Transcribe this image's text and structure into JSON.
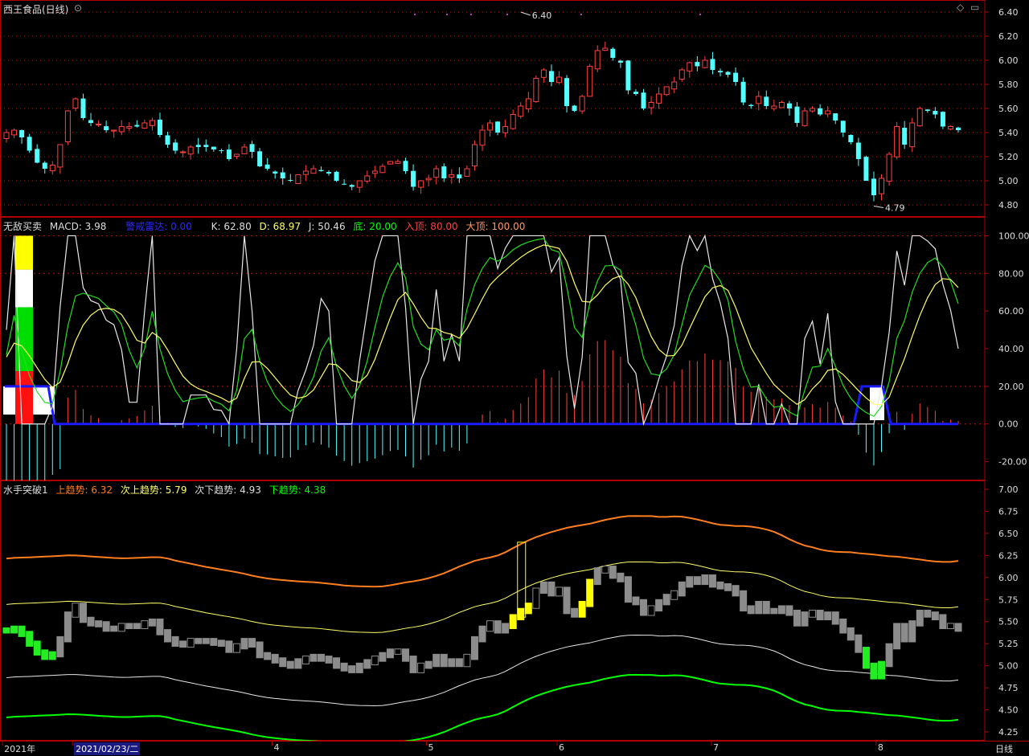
{
  "colors": {
    "up": "#ff4040",
    "down": "#54ffff",
    "grid_red": "#c01010",
    "frame": "#b00000",
    "white": "#e8e8e8",
    "yellow": "#ffff66",
    "green": "#00ff00",
    "blue": "#1a1aff",
    "orange": "#ff7f1e",
    "gray": "#8c8c8c",
    "peach": "#f2be96"
  },
  "header": {
    "stock_name": "西王食品(日线)",
    "dropdown_icon": "chevron-down-icon",
    "diamond_icon": "diamond-icon",
    "scroll_icon": "scroll-handle-icon"
  },
  "indicator1": {
    "name": "无敌买卖",
    "macd_label": "MACD: 3.98",
    "radar_label": "警戒雷达: 0.00",
    "k_label": "K: 62.80",
    "d_label": "D: 68.97",
    "j_label": "J: 50.46",
    "bottom_label": "底: 20.00",
    "entry_top_label": "入顶: 80.00",
    "big_top_label": "大顶: 100.00"
  },
  "indicator2": {
    "name": "水手突破1",
    "up_trend_label": "上趋势: 6.32",
    "sub_up_label": "次上趋势: 5.79",
    "sub_down_label": "次下趋势: 4.93",
    "down_trend_label": "下趋势: 4.38"
  },
  "datebar": {
    "labels": [
      {
        "text": "2021年",
        "pos": 0.004
      },
      {
        "text": "2021/02/23/二",
        "pos": 0.072,
        "selected": true
      },
      {
        "text": "4",
        "pos": 0.266
      },
      {
        "text": "5",
        "pos": 0.416
      },
      {
        "text": "6",
        "pos": 0.543
      },
      {
        "text": "7",
        "pos": 0.693
      },
      {
        "text": "8",
        "pos": 0.853
      }
    ],
    "period": "日线"
  },
  "chart_data": [
    {
      "type": "candlestick",
      "ylim": [
        4.7,
        6.5
      ],
      "y_ticks": [
        "6.40",
        "6.20",
        "6.00",
        "5.80",
        "5.60",
        "5.40",
        "5.20",
        "5.00",
        "4.80"
      ],
      "annotations": [
        {
          "text": "6.40",
          "label": "high"
        },
        {
          "text": "4.79",
          "label": "low"
        }
      ],
      "close_path": [
        5.4,
        5.42,
        5.36,
        5.25,
        5.15,
        5.1,
        5.13,
        5.3,
        5.58,
        5.68,
        5.52,
        5.48,
        5.47,
        5.42,
        5.42,
        5.45,
        5.45,
        5.45,
        5.48,
        5.5,
        5.38,
        5.3,
        5.25,
        5.24,
        5.28,
        5.28,
        5.28,
        5.26,
        5.25,
        5.18,
        5.22,
        5.28,
        5.24,
        5.12,
        5.1,
        5.06,
        5.02,
        5.0,
        5.05,
        5.08,
        5.1,
        5.08,
        5.06,
        5.0,
        4.97,
        4.95,
        5.0,
        5.04,
        5.08,
        5.12,
        5.16,
        5.16,
        5.08,
        4.95,
        5.0,
        5.02,
        5.1,
        5.02,
        5.05,
        5.02,
        5.1,
        5.3,
        5.42,
        5.48,
        5.4,
        5.45,
        5.55,
        5.62,
        5.68,
        5.85,
        5.92,
        5.82,
        5.86,
        5.62,
        5.58,
        5.7,
        5.95,
        6.08,
        6.1,
        6.02,
        5.98,
        5.75,
        5.72,
        5.6,
        5.65,
        5.72,
        5.78,
        5.82,
        5.92,
        5.98,
        5.95,
        6.0,
        5.92,
        5.9,
        5.88,
        5.82,
        5.65,
        5.62,
        5.7,
        5.62,
        5.62,
        5.65,
        5.6,
        5.48,
        5.58,
        5.6,
        5.55,
        5.58,
        5.5,
        5.4,
        5.32,
        5.18,
        5.0,
        4.88,
        5.02,
        5.22,
        5.45,
        5.3,
        5.48,
        5.6,
        5.58,
        5.55,
        5.45,
        5.45,
        5.42
      ]
    },
    {
      "type": "macd_kdj",
      "ylim": [
        -30,
        110
      ],
      "y_ticks": [
        "100.00",
        "80.00",
        "60.00",
        "40.00",
        "20.00",
        "0.00",
        "-20.00"
      ],
      "series": [
        {
          "name": "K",
          "color": "white"
        },
        {
          "name": "D",
          "color": "green"
        },
        {
          "name": "J",
          "color": "yellow"
        }
      ],
      "reference_lines": [
        100,
        80,
        20,
        0
      ]
    },
    {
      "type": "channel",
      "ylim": [
        4.15,
        7.1
      ],
      "y_ticks": [
        "7.00",
        "6.75",
        "6.50",
        "6.25",
        "6.00",
        "5.75",
        "5.50",
        "5.25",
        "5.00",
        "4.75",
        "4.50",
        "4.25"
      ],
      "series": [
        {
          "name": "上趋势",
          "color": "orange"
        },
        {
          "name": "次上趋势",
          "color": "yellow"
        },
        {
          "name": "次下趋势",
          "color": "white"
        },
        {
          "name": "下趋势",
          "color": "green"
        }
      ]
    }
  ]
}
